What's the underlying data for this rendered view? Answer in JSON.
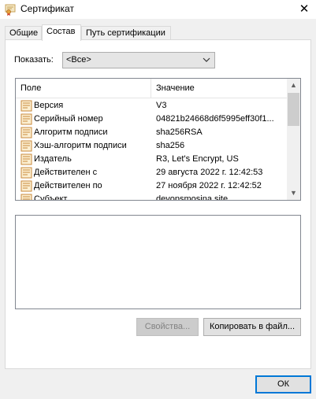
{
  "window": {
    "title": "Сертификат",
    "close_glyph": "✕"
  },
  "tabs": [
    {
      "label": "Общие"
    },
    {
      "label": "Состав"
    },
    {
      "label": "Путь сертификации"
    }
  ],
  "show": {
    "label": "Показать:",
    "value": "<Все>"
  },
  "table": {
    "col_field": "Поле",
    "col_value": "Значение",
    "rows": [
      {
        "field": "Версия",
        "value": "V3"
      },
      {
        "field": "Серийный номер",
        "value": "04821b24668d6f5995eff30f1..."
      },
      {
        "field": "Алгоритм подписи",
        "value": "sha256RSA"
      },
      {
        "field": "Хэш-алгоритм подписи",
        "value": "sha256"
      },
      {
        "field": "Издатель",
        "value": "R3, Let's Encrypt, US"
      },
      {
        "field": "Действителен с",
        "value": "29 августа 2022 г. 12:42:53"
      },
      {
        "field": "Действителен по",
        "value": "27 ноября 2022 г. 12:42:52"
      },
      {
        "field": "Субъект",
        "value": "devopsmosina.site"
      }
    ]
  },
  "buttons": {
    "properties": "Свойства...",
    "copy_to_file": "Копировать в файл...",
    "ok": "ОК"
  },
  "colors": {
    "accent": "#0078d7",
    "window_bg": "#f0f0f0"
  }
}
